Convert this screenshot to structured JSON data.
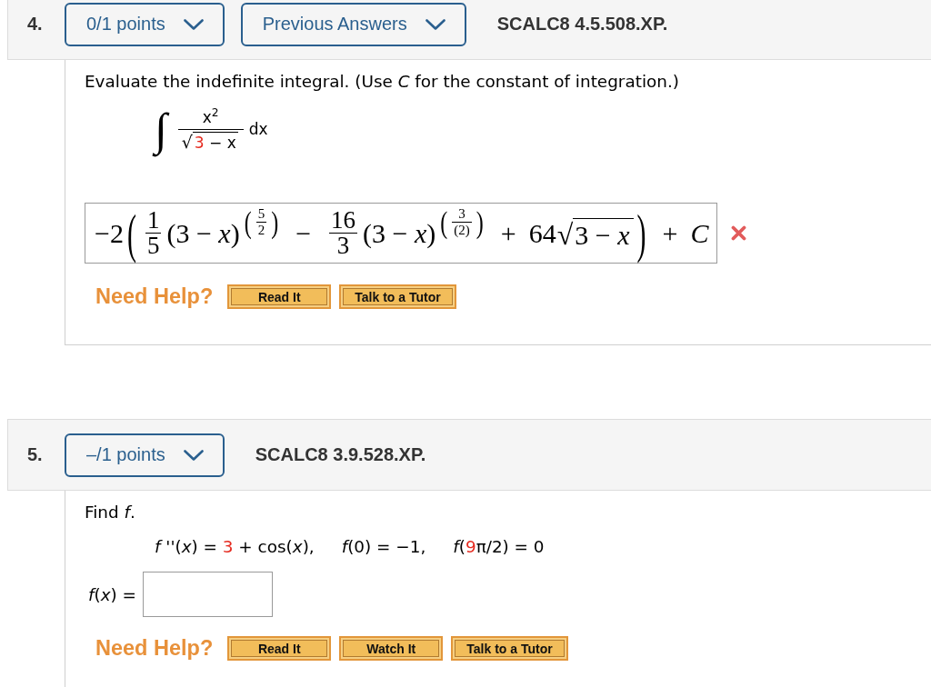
{
  "questions": [
    {
      "number": "4.",
      "points": "0/1 points",
      "previous_answers": "Previous Answers",
      "code": "SCALC8 4.5.508.XP.",
      "prompt": "Evaluate the indefinite integral. (Use *C* for the constant of integration.)",
      "integral": {
        "sign": "∫",
        "numerator": "x$^{2}$",
        "radical": "√",
        "radicand": [
          {
            "text": "3",
            "highlight": true
          },
          {
            "text": " − x",
            "highlight": false
          }
        ],
        "differential": "dx"
      },
      "answer": {
        "correct": false,
        "tokens": [
          {
            "kind": "text",
            "text": "−2"
          },
          {
            "kind": "big_paren",
            "text": "("
          },
          {
            "kind": "fraction",
            "numerator": "1",
            "denominator": "5"
          },
          {
            "kind": "text",
            "text": "(3 − *x*)"
          },
          {
            "kind": "power",
            "open": "(",
            "numerator": "5",
            "denominator": "2",
            "close": ")"
          },
          {
            "kind": "operator",
            "text": "−"
          },
          {
            "kind": "fraction",
            "numerator": "16",
            "denominator": "3"
          },
          {
            "kind": "text",
            "text": "(3 − *x*)"
          },
          {
            "kind": "power",
            "open": "(",
            "numerator": "3",
            "denominator": "(2)",
            "close": ")"
          },
          {
            "kind": "operator",
            "text": "+"
          },
          {
            "kind": "text",
            "text": "64"
          },
          {
            "kind": "sqrt",
            "sign": "√",
            "radicand": "3 − *x*"
          },
          {
            "kind": "big_paren",
            "text": ")"
          },
          {
            "kind": "operator",
            "text": "+"
          },
          {
            "kind": "text",
            "text": "*C*"
          }
        ]
      },
      "help": {
        "label": "Need Help?",
        "buttons": [
          "Read It",
          "Talk to a Tutor"
        ]
      }
    },
    {
      "number": "5.",
      "points": "–/1 points",
      "code": "SCALC8 3.9.528.XP.",
      "prompt": "Find *f*.",
      "conditions": [
        {
          "parts": [
            {
              "text": "*f* ''(*x*) = ",
              "highlight": false
            },
            {
              "text": "3",
              "highlight": true
            },
            {
              "text": " + cos(*x*),",
              "highlight": false
            }
          ]
        },
        {
          "parts": [
            {
              "text": "*f*(0) = −1,",
              "highlight": false
            }
          ]
        },
        {
          "parts": [
            {
              "text": "*f*(",
              "highlight": false
            },
            {
              "text": "9",
              "highlight": true
            },
            {
              "text": "π/2) = 0",
              "highlight": false
            }
          ]
        }
      ],
      "answer": {
        "label": "*f*(*x*) ="
      },
      "help": {
        "label": "Need Help?",
        "buttons": [
          "Read It",
          "Watch It",
          "Talk to a Tutor"
        ]
      }
    }
  ]
}
